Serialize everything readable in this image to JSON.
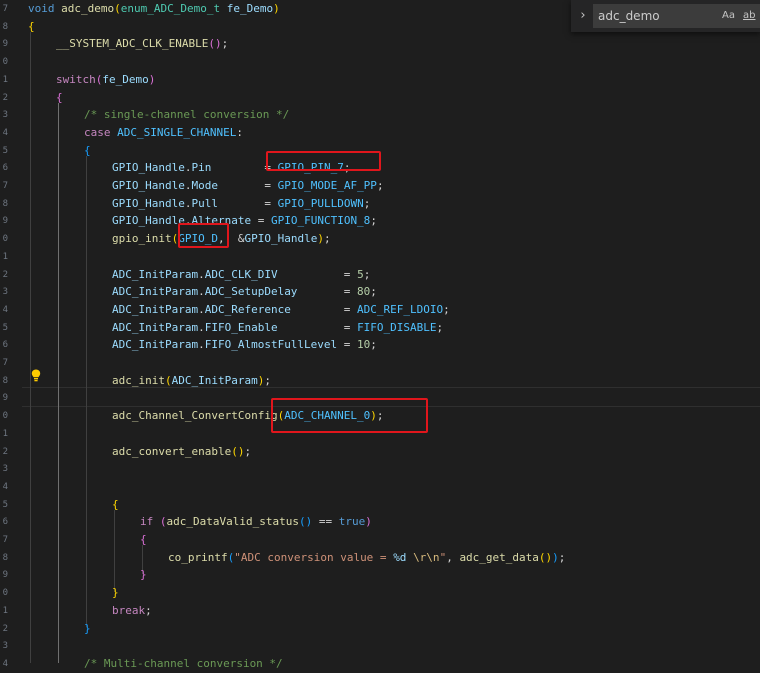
{
  "editor": {
    "line_numbers": [
      "7",
      "8",
      "9",
      "0",
      "1",
      "2",
      "3",
      "4",
      "5",
      "6",
      "7",
      "8",
      "9",
      "0",
      "1",
      "2",
      "3",
      "4",
      "5",
      "6",
      "7",
      "8",
      "9",
      "0",
      "1",
      "2",
      "3",
      "4",
      "5",
      "6",
      "7",
      "8",
      "9",
      "0",
      "1",
      "2",
      "3",
      "4"
    ],
    "lines": [
      [
        [
          "kw",
          "void "
        ],
        [
          "fn",
          "adc_demo"
        ],
        [
          "br1",
          "("
        ],
        [
          "type",
          "enum_ADC_Demo_t "
        ],
        [
          "var",
          "fe_Demo"
        ],
        [
          "br1",
          ")"
        ]
      ],
      [
        [
          "br1",
          "{"
        ]
      ],
      [
        [
          "fn",
          "__SYSTEM_ADC_CLK_ENABLE"
        ],
        [
          "br2",
          "()"
        ],
        [
          "",
          "; "
        ]
      ],
      [],
      [
        [
          "ctl",
          "switch"
        ],
        [
          "br2",
          "("
        ],
        [
          "var",
          "fe_Demo"
        ],
        [
          "br2",
          ")"
        ]
      ],
      [
        [
          "br2",
          "{"
        ]
      ],
      [
        [
          "cmt",
          "/* single-channel conversion */"
        ]
      ],
      [
        [
          "ctl",
          "case "
        ],
        [
          "mac",
          "ADC_SINGLE_CHANNEL"
        ],
        [
          "",
          ":"
        ]
      ],
      [
        [
          "br3",
          "{"
        ]
      ],
      [
        [
          "var",
          "GPIO_Handle"
        ],
        [
          "",
          "."
        ],
        [
          "var",
          "Pin"
        ],
        [
          "",
          "        = "
        ],
        [
          "mac",
          "GPIO_PIN_7"
        ],
        [
          "",
          ";"
        ]
      ],
      [
        [
          "var",
          "GPIO_Handle"
        ],
        [
          "",
          "."
        ],
        [
          "var",
          "Mode"
        ],
        [
          "",
          "       = "
        ],
        [
          "mac",
          "GPIO_MODE_AF_PP"
        ],
        [
          "",
          ";"
        ]
      ],
      [
        [
          "var",
          "GPIO_Handle"
        ],
        [
          "",
          "."
        ],
        [
          "var",
          "Pull"
        ],
        [
          "",
          "       = "
        ],
        [
          "mac",
          "GPIO_PULLDOWN"
        ],
        [
          "",
          ";"
        ]
      ],
      [
        [
          "var",
          "GPIO_Handle"
        ],
        [
          "",
          "."
        ],
        [
          "var",
          "Alternate"
        ],
        [
          "",
          " = "
        ],
        [
          "mac",
          "GPIO_FUNCTION_8"
        ],
        [
          "",
          ";"
        ]
      ],
      [
        [
          "fn",
          "gpio_init"
        ],
        [
          "br1",
          "("
        ],
        [
          "mac",
          "GPIO_D"
        ],
        [
          "",
          ",  &"
        ],
        [
          "var",
          "GPIO_Handle"
        ],
        [
          "br1",
          ")"
        ],
        [
          "",
          ";"
        ]
      ],
      [],
      [
        [
          "var",
          "ADC_InitParam"
        ],
        [
          "",
          "."
        ],
        [
          "var",
          "ADC_CLK_DIV"
        ],
        [
          "",
          "          = "
        ],
        [
          "num",
          "5"
        ],
        [
          "",
          ";"
        ]
      ],
      [
        [
          "var",
          "ADC_InitParam"
        ],
        [
          "",
          "."
        ],
        [
          "var",
          "ADC_SetupDelay"
        ],
        [
          "",
          "       = "
        ],
        [
          "num",
          "80"
        ],
        [
          "",
          ";"
        ]
      ],
      [
        [
          "var",
          "ADC_InitParam"
        ],
        [
          "",
          "."
        ],
        [
          "var",
          "ADC_Reference"
        ],
        [
          "",
          "        = "
        ],
        [
          "mac",
          "ADC_REF_LDOIO"
        ],
        [
          "",
          ";"
        ]
      ],
      [
        [
          "var",
          "ADC_InitParam"
        ],
        [
          "",
          "."
        ],
        [
          "var",
          "FIFO_Enable"
        ],
        [
          "",
          "          = "
        ],
        [
          "mac",
          "FIFO_DISABLE"
        ],
        [
          "",
          ";"
        ]
      ],
      [
        [
          "var",
          "ADC_InitParam"
        ],
        [
          "",
          "."
        ],
        [
          "var",
          "FIFO_AlmostFullLevel"
        ],
        [
          "",
          " = "
        ],
        [
          "num",
          "10"
        ],
        [
          "",
          ";"
        ]
      ],
      [],
      [
        [
          "fn",
          "adc_init"
        ],
        [
          "br1",
          "("
        ],
        [
          "var",
          "ADC_InitParam"
        ],
        [
          "br1",
          ")"
        ],
        [
          "",
          ";"
        ]
      ],
      [],
      [
        [
          "fn",
          "adc_Channel_ConvertConfig"
        ],
        [
          "br1",
          "("
        ],
        [
          "mac",
          "ADC_CHANNEL_0"
        ],
        [
          "br1",
          ")"
        ],
        [
          "",
          ";"
        ]
      ],
      [],
      [
        [
          "fn",
          "adc_convert_enable"
        ],
        [
          "br1",
          "()"
        ],
        [
          "",
          ";"
        ]
      ],
      [],
      [],
      [
        [
          "br1",
          "{"
        ]
      ],
      [
        [
          "ctl",
          "if "
        ],
        [
          "br2",
          "("
        ],
        [
          "fn",
          "adc_DataValid_status"
        ],
        [
          "br3",
          "()"
        ],
        [
          "",
          " == "
        ],
        [
          "kw",
          "true"
        ],
        [
          "br2",
          ")"
        ]
      ],
      [
        [
          "br2",
          "{"
        ]
      ],
      [
        [
          "fn",
          "co_printf"
        ],
        [
          "br3",
          "("
        ],
        [
          "str",
          "\"ADC conversion value = "
        ],
        [
          "var",
          "%d"
        ],
        [
          "str",
          " "
        ],
        [
          "esc",
          "\\r\\n"
        ],
        [
          "str",
          "\""
        ],
        [
          "",
          ", "
        ],
        [
          "fn",
          "adc_get_data"
        ],
        [
          "br1",
          "()"
        ],
        [
          "br3",
          ")"
        ],
        [
          "",
          ";"
        ]
      ],
      [
        [
          "br2",
          "}"
        ]
      ],
      [
        [
          "br1",
          "}"
        ]
      ],
      [
        [
          "ctl",
          "break"
        ],
        [
          "",
          ";"
        ]
      ],
      [
        [
          "br3",
          "}"
        ]
      ],
      [],
      [
        [
          "cmt",
          "/* Multi-channel conversion */"
        ]
      ]
    ]
  },
  "find": {
    "toggle_glyph": "›",
    "query": "adc_demo",
    "match_case": "Aa",
    "whole_word": "ab"
  },
  "colors": {
    "highlight_box": "#e0161c",
    "lightbulb": "#ffcc00"
  }
}
